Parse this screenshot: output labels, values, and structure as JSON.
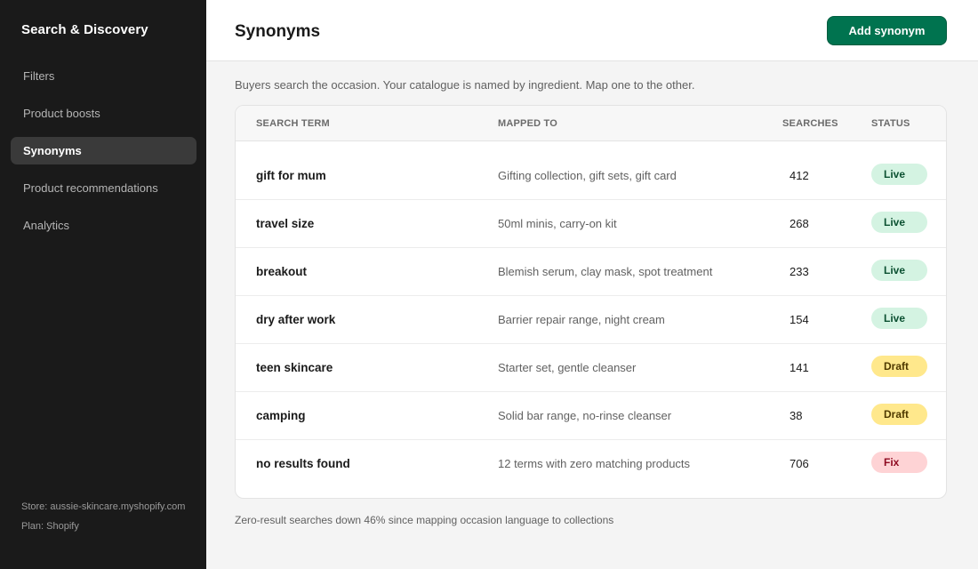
{
  "sidebar": {
    "app_title": "Search & Discovery",
    "items": [
      {
        "label": "Filters",
        "active": false
      },
      {
        "label": "Product boosts",
        "active": false
      },
      {
        "label": "Synonyms",
        "active": true
      },
      {
        "label": "Product recommendations",
        "active": false
      },
      {
        "label": "Analytics",
        "active": false
      }
    ],
    "store": "Store: aussie-skincare.myshopify.com",
    "plan": "Plan: Shopify"
  },
  "header": {
    "title": "Synonyms",
    "add_button": "Add synonym"
  },
  "main": {
    "intro": "Buyers search the occasion. Your catalogue is named by ingredient. Map one to the other.",
    "columns": [
      "SEARCH TERM",
      "MAPPED TO",
      "SEARCHES",
      "STATUS"
    ],
    "rows": [
      {
        "term": "gift for mum",
        "mapped": "Gifting collection, gift sets, gift card",
        "searches": "412",
        "status": "Live",
        "status_type": "live"
      },
      {
        "term": "travel size",
        "mapped": "50ml minis, carry-on kit",
        "searches": "268",
        "status": "Live",
        "status_type": "live"
      },
      {
        "term": "breakout",
        "mapped": "Blemish serum, clay mask, spot treatment",
        "searches": "233",
        "status": "Live",
        "status_type": "live"
      },
      {
        "term": "dry after work",
        "mapped": "Barrier repair range, night cream",
        "searches": "154",
        "status": "Live",
        "status_type": "live"
      },
      {
        "term": "teen skincare",
        "mapped": "Starter set, gentle cleanser",
        "searches": "141",
        "status": "Draft",
        "status_type": "draft"
      },
      {
        "term": "camping",
        "mapped": "Solid bar range, no-rinse cleanser",
        "searches": "38",
        "status": "Draft",
        "status_type": "draft"
      },
      {
        "term": "no results found",
        "mapped": "12 terms with zero matching products",
        "searches": "706",
        "status": "Fix",
        "status_type": "fix"
      }
    ],
    "footer_note": "Zero-result searches down 46% since mapping occasion language to collections"
  },
  "colors": {
    "sidebar_bg": "#1a1a1a",
    "primary_button": "#00734f",
    "badge_live": "#d4f3e2",
    "badge_draft": "#ffe88c",
    "badge_fix": "#fed3d5"
  }
}
